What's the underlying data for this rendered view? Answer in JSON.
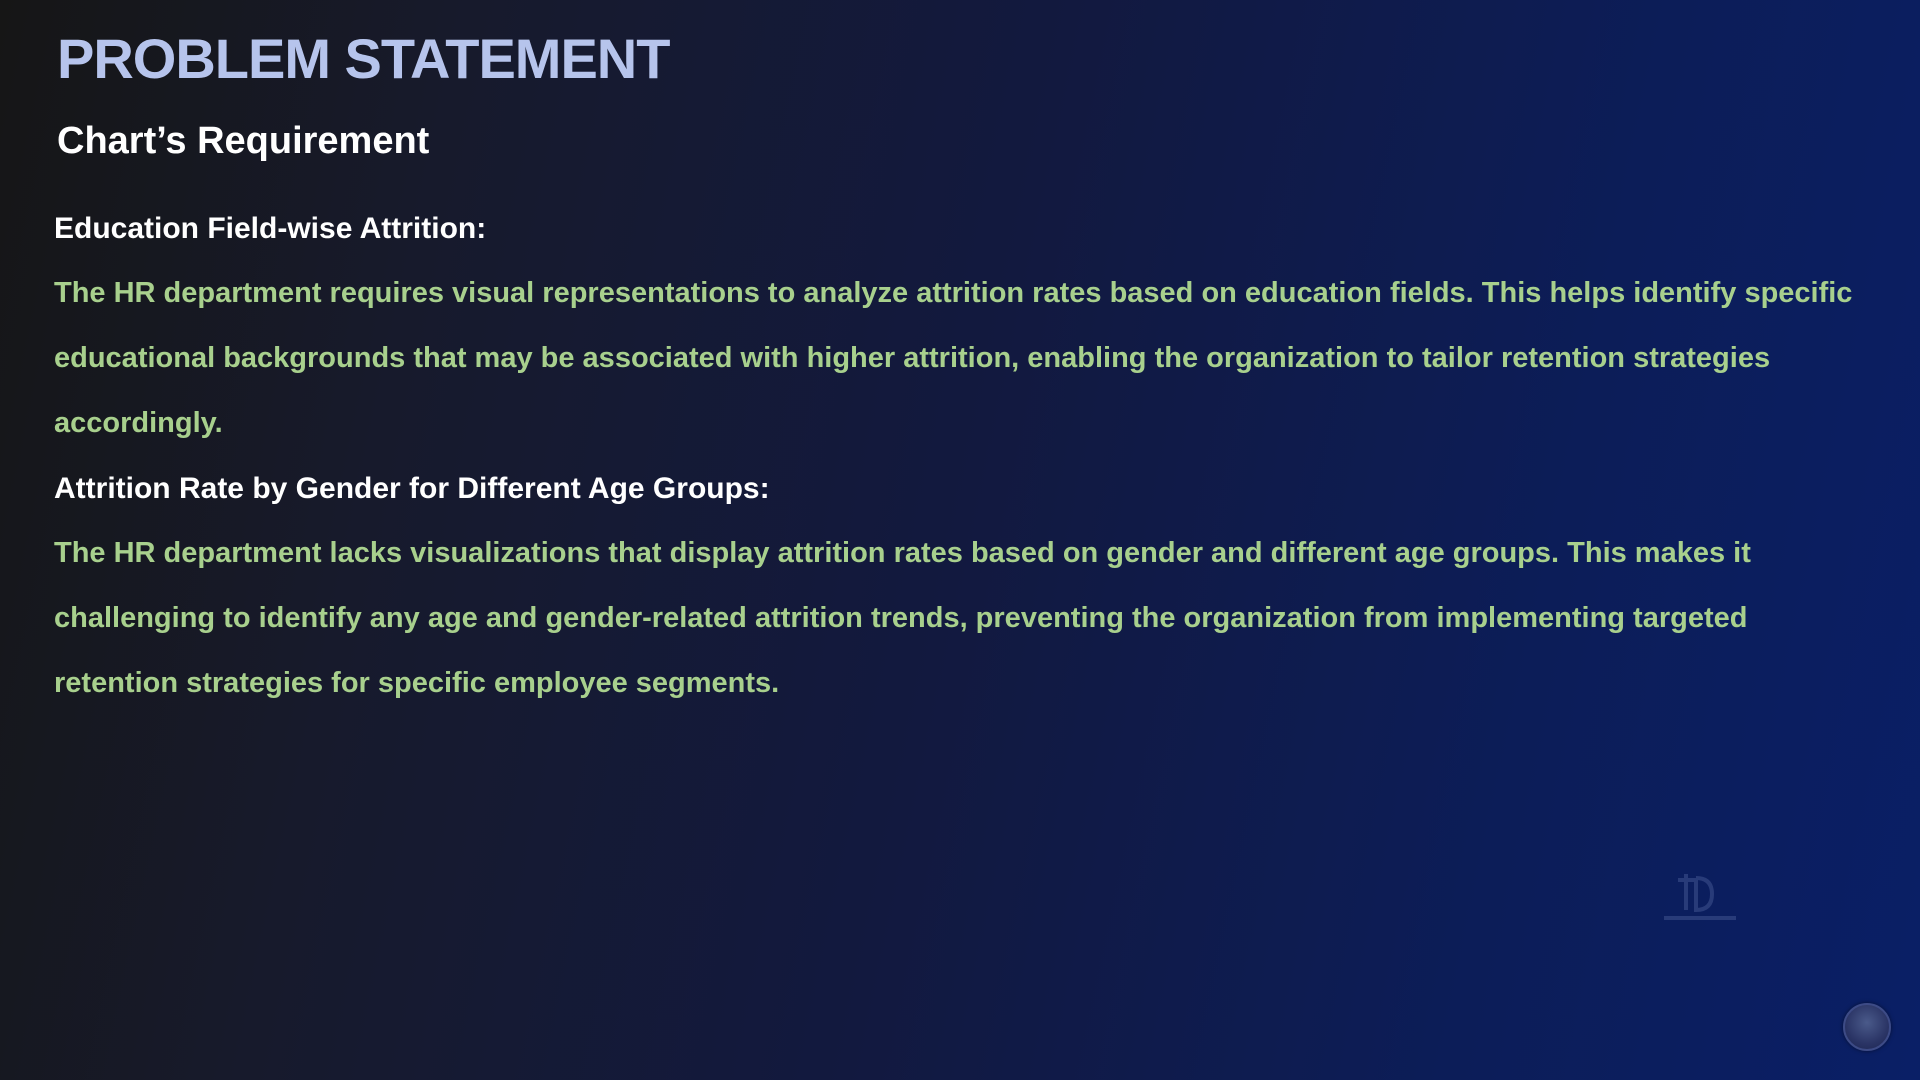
{
  "slide": {
    "title": "PROBLEM STATEMENT",
    "subtitle": "Chart’s Requirement",
    "sections": [
      {
        "heading": "Education Field-wise Attrition:",
        "body": "The HR department requires visual representations to analyze attrition rates based on education fields. This helps identify specific educational backgrounds that may be associated with higher attrition, enabling the organization to tailor retention strategies accordingly."
      },
      {
        "heading": "Attrition Rate by Gender for Different Age Groups:",
        "body": "The HR department lacks visualizations that display attrition rates based on gender and different age groups. This makes it challenging to identify any age and gender-related attrition trends, preventing the organization from implementing targeted retention strategies for specific employee segments."
      }
    ]
  },
  "colors": {
    "title": "#b6c4ec",
    "subtitle": "#ffffff",
    "heading": "#ffffff",
    "body": "#a8d08d",
    "background_start": "#161616",
    "background_end": "#0a1f66"
  },
  "icons": {
    "watermark": "logo-watermark-icon",
    "badge": "avatar-badge-icon"
  }
}
